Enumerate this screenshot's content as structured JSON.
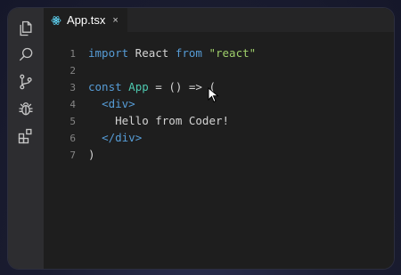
{
  "tabs": [
    {
      "label": "App.tsx",
      "close": "×"
    }
  ],
  "activity_bar": {
    "items": [
      "files-icon",
      "search-icon",
      "source-control-icon",
      "debug-icon",
      "extensions-icon"
    ]
  },
  "code_lines": [
    {
      "num": "1",
      "tokens": [
        [
          "kw",
          "import"
        ],
        [
          "id",
          " React "
        ],
        [
          "kw",
          "from"
        ],
        [
          "id",
          " "
        ],
        [
          "str-green",
          "\"react\""
        ]
      ]
    },
    {
      "num": "2",
      "tokens": []
    },
    {
      "num": "3",
      "tokens": [
        [
          "kw",
          "const"
        ],
        [
          "id",
          " "
        ],
        [
          "fn",
          "App"
        ],
        [
          "id",
          " = () => ("
        ]
      ]
    },
    {
      "num": "4",
      "tokens": [
        [
          "id",
          "  "
        ],
        [
          "tag",
          "<div>"
        ]
      ]
    },
    {
      "num": "5",
      "tokens": [
        [
          "txt",
          "    Hello from Coder!"
        ]
      ]
    },
    {
      "num": "6",
      "tokens": [
        [
          "id",
          "  "
        ],
        [
          "tag",
          "</div>"
        ]
      ]
    },
    {
      "num": "7",
      "tokens": [
        [
          "punct",
          ")"
        ]
      ]
    }
  ],
  "colors": {
    "accent": "#569cd6",
    "string": "#9ece6a",
    "background": "#1e1e1e"
  }
}
